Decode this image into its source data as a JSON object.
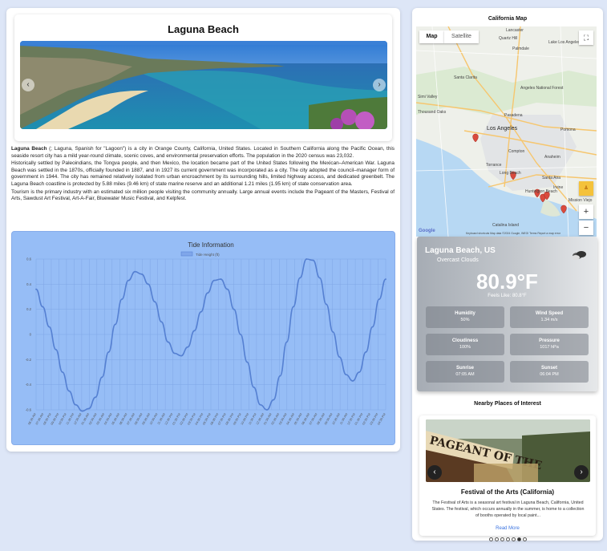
{
  "city": {
    "title": "Laguna Beach",
    "description": [
      {
        "bold": "Laguna Beach",
        "text": " (; Laguna, Spanish for \"Lagoon\") is a city in Orange County, California, United States. Located in Southern California along the Pacific Ocean, this seaside resort city has a mild year-round climate, scenic coves, and environmental preservation efforts. The population in the 2020 census was 23,032."
      },
      {
        "bold": "",
        "text": "Historically settled by Paleoindians, the Tongva people, and then Mexico, the location became part of the United States following the Mexican–American War. Laguna Beach was settled in the 1870s, officially founded in 1887, and in 1927 its current government was incorporated as a city. The city adopted the council–manager form of government in 1944. The city has remained relatively isolated from urban encroachment by its surrounding hills, limited highway access, and dedicated greenbelt. The Laguna Beach coastline is protected by 5.88 miles (9.46 km) of state marine reserve and an additional 1.21 miles (1.95 km) of state conservation area."
      },
      {
        "bold": "",
        "text": "Tourism is the primary industry with an estimated six million people visiting the community annually. Large annual events include the Pageant of the Masters, Festival of Arts, Sawdust Art Festival, Art-A-Fair, Bluewater Music Festival, and Kelpfest."
      }
    ],
    "carousel": {
      "prev": "‹",
      "next": "›"
    }
  },
  "chart_data": {
    "type": "line",
    "title": "Tide Information",
    "legend": [
      "Tide Height (ft)"
    ],
    "legend_position": "top",
    "grid": true,
    "y_ticks": [
      "0.6",
      "0.4",
      "0.2",
      "0",
      "-0.2",
      "-0.4",
      "-0.6"
    ],
    "ylim": [
      -0.6,
      0.6
    ],
    "categories": [
      "06:30 AM",
      "07:30 AM",
      "08:30 PM",
      "09:30 PM",
      "10:30 PM",
      "11:30 PM",
      "12:30 AM",
      "01:30 AM",
      "02:30 AM",
      "03:30 AM",
      "04:30 AM",
      "05:30 AM",
      "06:30 AM",
      "07:30 AM",
      "08:30 AM",
      "09:30 AM",
      "10:30 AM",
      "11:30 AM",
      "12:30 PM",
      "01:30 PM",
      "02:30 PM",
      "03:30 PM",
      "04:30 PM",
      "05:30 PM",
      "06:30 PM",
      "07:30 PM",
      "08:30 PM",
      "09:30 PM",
      "10:30 PM",
      "11:30 PM",
      "12:30 AM",
      "01:30 AM",
      "02:30 AM",
      "03:30 AM",
      "04:30 AM",
      "05:30 AM",
      "06:30 AM",
      "07:30 AM",
      "08:30 AM",
      "09:30 AM",
      "10:30 AM",
      "11:30 AM",
      "12:30 PM",
      "01:30 PM",
      "02:30 PM",
      "03:30 PM",
      "04:30 PM"
    ],
    "series": [
      {
        "name": "Tide Height (ft)",
        "values": [
          0.36,
          0.22,
          0.06,
          -0.12,
          -0.3,
          -0.45,
          -0.56,
          -0.61,
          -0.59,
          -0.5,
          -0.34,
          -0.14,
          0.08,
          0.28,
          0.43,
          0.5,
          0.48,
          0.4,
          0.26,
          0.1,
          -0.06,
          -0.15,
          -0.17,
          -0.1,
          0.03,
          0.18,
          0.33,
          0.43,
          0.44,
          0.36,
          0.2,
          0.0,
          -0.22,
          -0.42,
          -0.56,
          -0.6,
          -0.52,
          -0.33,
          -0.06,
          0.22,
          0.45,
          0.6,
          0.59,
          0.45,
          0.24,
          0.02,
          -0.18,
          -0.32,
          -0.37,
          -0.3,
          -0.14,
          0.06,
          0.28,
          0.44
        ]
      }
    ]
  },
  "map": {
    "title": "California Map",
    "map_tab": "Map",
    "satellite_tab": "Satellite",
    "labels": [
      "Lancaster",
      "Quartz Hill",
      "Palmdale",
      "Lake Los Angeles",
      "Santa Clarita",
      "Angeles National Forest",
      "Simi Valley",
      "Thousand Oaks",
      "Pasadena",
      "Los Angeles",
      "Pomona",
      "Compton",
      "Anaheim",
      "Torrance",
      "Long Beach",
      "Santa Ana",
      "Irvine",
      "Huntington Beach",
      "Mission Viejo",
      "Catalina Island"
    ],
    "zoom_in": "+",
    "zoom_out": "−",
    "fullscreen": "⛶",
    "pegman": "♟",
    "google": "Google",
    "attribution": "Keyboard shortcuts   Map data ©2024 Google, INEGI   Terms   Report a map error"
  },
  "weather": {
    "city": "Laguna Beach, US",
    "condition": "Overcast Clouds",
    "temperature": "80.9°F",
    "feels_like": "Feels Like: 80.8°F",
    "stats": [
      {
        "label": "Humidity",
        "value": "50%"
      },
      {
        "label": "Wind Speed",
        "value": "1.34 m/s"
      },
      {
        "label": "Cloudiness",
        "value": "100%"
      },
      {
        "label": "Pressure",
        "value": "1017 hPa"
      },
      {
        "label": "Sunrise",
        "value": "07:05 AM"
      },
      {
        "label": "Sunset",
        "value": "06:04 PM"
      }
    ]
  },
  "poi": {
    "title": "Nearby Places of Interest",
    "name": "Festival of the Arts (California)",
    "description": "The Festival of Arts is a seasonal art festival in Laguna Beach, California, United States. The festival, which occurs annually in the summer, is home to a collection of booths operated by local paint...",
    "read_more": "Read More",
    "sign_text": "PAGEANT OF THE",
    "prev": "‹",
    "next": "›",
    "dots_count": 7,
    "active_dot": 5
  }
}
